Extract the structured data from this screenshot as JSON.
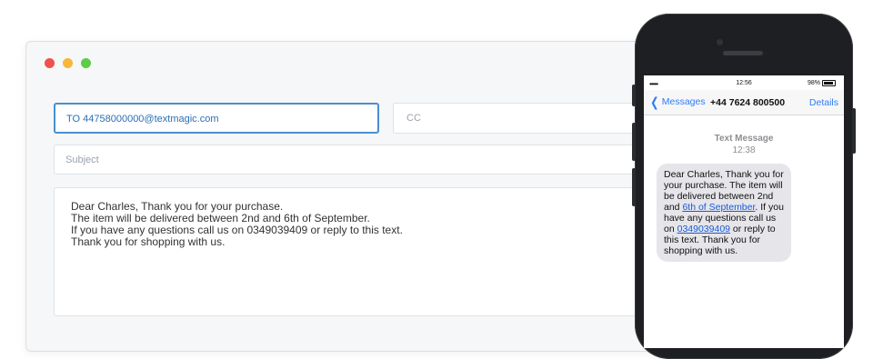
{
  "email": {
    "to_value": "TO  44758000000@textmagic.com",
    "cc_placeholder": "CC",
    "subject_placeholder": "Subject",
    "body_lines": [
      "Dear Charles, Thank you for your purchase.",
      "The item will be delivered between 2nd and 6th of September.",
      "If you have any questions call us on 0349039409 or reply to this text.",
      "Thank you for shopping with us."
    ]
  },
  "phone": {
    "status": {
      "signal": "•••••",
      "time": "12:56",
      "battery": "98%"
    },
    "nav": {
      "back_label": "Messages",
      "title": "+44 7624 800500",
      "details_label": "Details"
    },
    "message_header": {
      "label": "Text Message",
      "time": "12:38"
    },
    "bubble": {
      "text_1": "Dear Charles, Thank you for your purchase. The item will be delivered between 2nd and ",
      "link_1": "6th of September",
      "text_2": ". If you have any questions call us on ",
      "link_2": "0349039409",
      "text_3": " or reply to this text. Thank you for shopping with us."
    }
  },
  "colors": {
    "accent_blue": "#4a8fd0",
    "ios_blue": "#2e7cf6",
    "dot_red": "#f0514c",
    "dot_yellow": "#f7b73a",
    "dot_green": "#5ccd47"
  }
}
